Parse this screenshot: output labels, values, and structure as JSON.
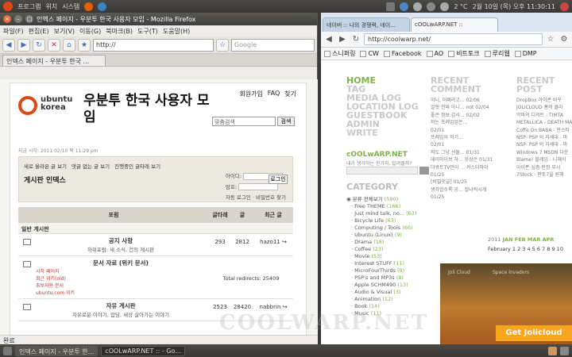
{
  "topbar": {
    "menu_apps": "프로그램",
    "menu_places": "위치",
    "menu_system": "시스템",
    "temperature": "2 °C",
    "datetime": "2월 10일 (목) 오후 11:30:11"
  },
  "firefox": {
    "title": "인엑스 페이지 - 우분투 한국 사용자 모임 - Mozilla Firefox",
    "menus": [
      "파일(F)",
      "편집(E)",
      "보기(V)",
      "이동(G)",
      "북마크(B)",
      "도구(T)",
      "도움말(H)"
    ],
    "url": "http://",
    "search_placeholder": "Google",
    "tab_label": "인덱스 페이지 - 우분투 한국 ...",
    "status": "완료",
    "page": {
      "logo_line1": "ubuntu",
      "logo_line2": "korea",
      "site_title": "우분투 한국 사용자 모임",
      "top_links": [
        "회원가입",
        "FAQ",
        "찾기"
      ],
      "google_search_placeholder": "맞춤검색",
      "google_search_button": "검색",
      "date_line": "지금 시각: 2011 02/10 목 11:29 pm",
      "panel_links": [
        "새로 올라온 글 보기",
        "댓글 없는 글 보기",
        "진행중인 글타래 보기"
      ],
      "index_label": "게시판 인덱스",
      "login_id_label": "아이디:",
      "login_pw_label": "암호:",
      "login_button": "로그인",
      "auto_login": "자동 로그인",
      "forgot_pw": "비밀번호 찾기",
      "table_headers": [
        "포럼",
        "글타래",
        "글",
        "최근 글"
      ],
      "category": "일반 게시판",
      "rows": [
        {
          "name": "공지 사항",
          "desc": "하위포럼: 새 소식, 건의 게시판",
          "topics": "293",
          "posts": "2812",
          "last": "hazo11 ↪"
        },
        {
          "name": "문서 자료 (위키 문서)",
          "desc": "",
          "links": [
            "시작 페이지",
            "최근 위키(old)",
            "초보자용 문서",
            "ubuntu.com 위키"
          ],
          "topics": "",
          "posts": "Total redirects: 25409",
          "last": ""
        },
        {
          "name": "자유 게시판",
          "desc": "자유로운 이야기, 잡담, 세상 살아가는 이야기",
          "topics": "2523",
          "posts": "28420",
          "last": "nabbrin ↪"
        }
      ]
    }
  },
  "chrome": {
    "tabs": [
      "네이버 :: 나의 경쟁력, 네이...",
      "cOOLwARP.NET ::"
    ],
    "url": "http://coolwarp.net/",
    "bookmarks": [
      "스니퍼링",
      "CW",
      "Facebook",
      "AO",
      "비트토크",
      "루리웹",
      "DMP"
    ],
    "blog": {
      "nav": [
        "HOME",
        "TAG",
        "MEDIA LOG",
        "LOCATION LOG",
        "GUESTBOOK",
        "ADMIN",
        "WRITE"
      ],
      "name": "cOOLwARP.NET",
      "tagline": "내가 생각하는 한가지, 알려줄까?",
      "category_head": "CATEGORY",
      "categories": [
        {
          "name": "분류 전체보기",
          "count": "(590)"
        },
        {
          "name": "Free THEME",
          "count": "(166)"
        },
        {
          "name": "Just mind talk, no...",
          "count": "(63)"
        },
        {
          "name": "Bicycle Life",
          "count": "(63)"
        },
        {
          "name": "Computing / Tools",
          "count": "(66)"
        },
        {
          "name": "Ubuntu (Linux)",
          "count": "(9)"
        },
        {
          "name": "Drama",
          "count": "(18)"
        },
        {
          "name": "Coffee",
          "count": "(23)"
        },
        {
          "name": "Movie",
          "count": "(53)"
        },
        {
          "name": "Interest STUFF",
          "count": "(11)"
        },
        {
          "name": "MicroFourThirds",
          "count": "(9)"
        },
        {
          "name": "PSP's and MP3s",
          "count": "(8)"
        },
        {
          "name": "Apple SCHM490",
          "count": "(13)"
        },
        {
          "name": "Audio & Visual",
          "count": "(3)"
        },
        {
          "name": "Animation",
          "count": "(12)"
        },
        {
          "name": "Book",
          "count": "(14)"
        },
        {
          "name": "Music",
          "count": "(11)"
        }
      ],
      "recent_comment_head": "RECENT COMMENT",
      "recent_comments": [
        "이니, 어쩌라고...  02/06",
        "얼핏 진짜 아니... not 02/04",
        "좋은 정보 감사... 02/02",
        "저는 프레임업은...",
        "02/01",
        "프레임의 학기...",
        "02/01",
        "저도 그냥 선물...  01/31",
        "데이미이브 하... 응상은 01/31",
        "더큐트TV만이 ... 커스터마이",
        "01/25",
        "[비밀댓글]  01/25",
        "생각합수록 공... 잡냐적시게",
        "01/25"
      ],
      "recent_post_head": "RECENT POST",
      "recent_posts": [
        "DropBox 아이콘 바꾸",
        "JOLICLOUD 홈의 클라",
        "악마의 디저트 - TIMTA",
        "METALLICA - DEATH MA",
        "Coffe On BABA - 안스타",
        "NSP- PSP 의 자세대 - 마",
        "NSP- PSP 의 자세대 - 마",
        "Windows 7 MSDN 다운",
        "Blame! 블레임 - 니헤이",
        "아이폰 심층 판정 부시",
        "7Stock - 판토7을 원해"
      ],
      "calendar_head": "2011",
      "calendar_months": "JAN FEB MAR APR",
      "calendar_row": "February 1 2 3 4 5 6 7 8 9 10",
      "ad_text1": "Joli Cloud",
      "ad_text2": "Space Invaders",
      "ad_button": "Get Jolicloud"
    }
  },
  "taskbar": {
    "tasks": [
      "인덱스 페이지 - 우분투 한...",
      "cOOLwARP.NET :: - Go..."
    ]
  },
  "watermark": "COOLWARP.NET"
}
